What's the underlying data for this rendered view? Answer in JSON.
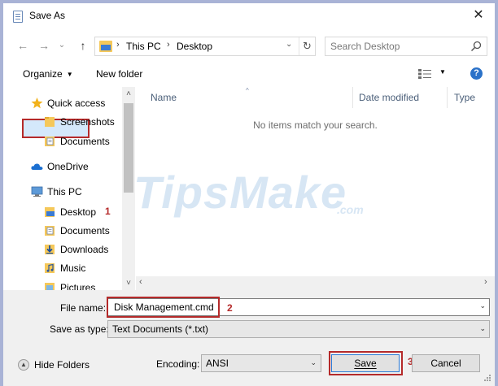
{
  "window": {
    "title": "Save As"
  },
  "nav": {
    "back": "←",
    "forward": "→",
    "up": "↑",
    "drop": "⌄"
  },
  "address": {
    "crumbs": [
      "This PC",
      "Desktop"
    ]
  },
  "search": {
    "placeholder": "Search Desktop"
  },
  "toolbar": {
    "organize": "Organize",
    "new_folder": "New folder"
  },
  "sidebar": {
    "items": [
      {
        "label": "Quick access",
        "icon": "star-icon"
      },
      {
        "label": "Screenshots",
        "icon": "folder-icon"
      },
      {
        "label": "Documents",
        "icon": "documents-icon"
      },
      {
        "label": "OneDrive",
        "icon": "cloud-icon"
      },
      {
        "label": "This PC",
        "icon": "computer-icon"
      },
      {
        "label": "Desktop",
        "icon": "desktop-folder-icon"
      },
      {
        "label": "Documents",
        "icon": "documents-icon"
      },
      {
        "label": "Downloads",
        "icon": "download-icon"
      },
      {
        "label": "Music",
        "icon": "music-icon"
      },
      {
        "label": "Pictures",
        "icon": "pictures-icon"
      }
    ]
  },
  "columns": {
    "name": "Name",
    "date": "Date modified",
    "type": "Type"
  },
  "empty_message": "No items match your search.",
  "watermark": {
    "main": "TipsMake",
    "suffix": ".com"
  },
  "form": {
    "file_name_label": "File name:",
    "file_name_value": "Disk Management.cmd",
    "save_type_label": "Save as type:",
    "save_type_value": "Text Documents (*.txt)",
    "encoding_label": "Encoding:",
    "encoding_value": "ANSI"
  },
  "buttons": {
    "hide_folders": "Hide Folders",
    "save": "Save",
    "cancel": "Cancel"
  },
  "markers": [
    "1",
    "2",
    "3"
  ],
  "colors": {
    "accent": "#2c7bd6",
    "highlight": "#b52a2a",
    "selection": "#d4e8fb"
  }
}
